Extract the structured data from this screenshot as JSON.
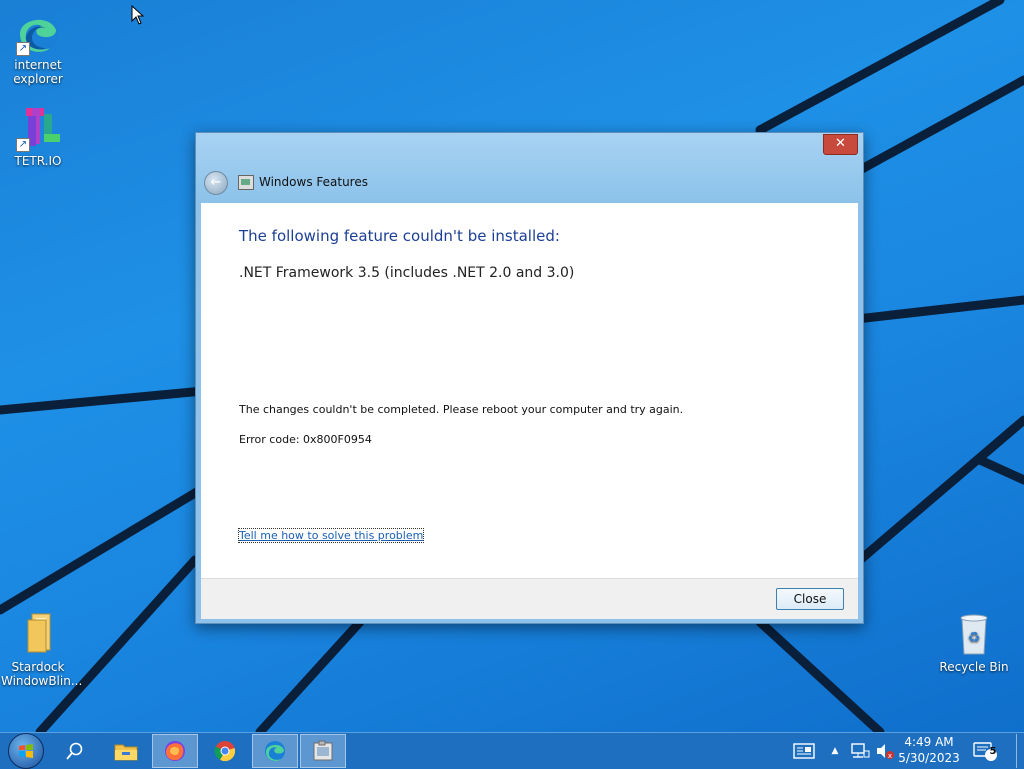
{
  "desktop": {
    "icons": [
      {
        "label": "internet explorer",
        "icon": "edge-icon"
      },
      {
        "label": "TETR.IO",
        "icon": "tetrio-icon"
      },
      {
        "label": "Stardock WindowBlin...",
        "icon": "folder-icon"
      },
      {
        "label": "Recycle Bin",
        "icon": "recycle-bin-icon"
      }
    ]
  },
  "dialog": {
    "title": "Windows Features",
    "close_glyph": "✕",
    "heading": "The following feature couldn't be installed:",
    "feature": ".NET Framework 3.5 (includes .NET 2.0 and 3.0)",
    "message": "The changes couldn't be completed. Please reboot your computer and try again.",
    "error_code": "Error code: 0x800F0954",
    "help_link": "Tell me how to solve this problem",
    "close_button": "Close"
  },
  "taskbar": {
    "items": [
      "start-button",
      "search-icon",
      "file-explorer-icon",
      "firefox-icon",
      "chrome-icon",
      "edge-icon",
      "windows-features-icon"
    ],
    "active": [
      "firefox-icon",
      "edge-icon",
      "windows-features-icon"
    ],
    "time": "4:49 AM",
    "date": "5/30/2023",
    "notification_count": "5"
  },
  "colors": {
    "desktop": "#1e90e6",
    "taskbar": "#1e6fc0",
    "title_bar": "#8cc2ea",
    "heading": "#1b3f95",
    "link": "#1a5fb4",
    "close_red": "#c74a3c"
  }
}
